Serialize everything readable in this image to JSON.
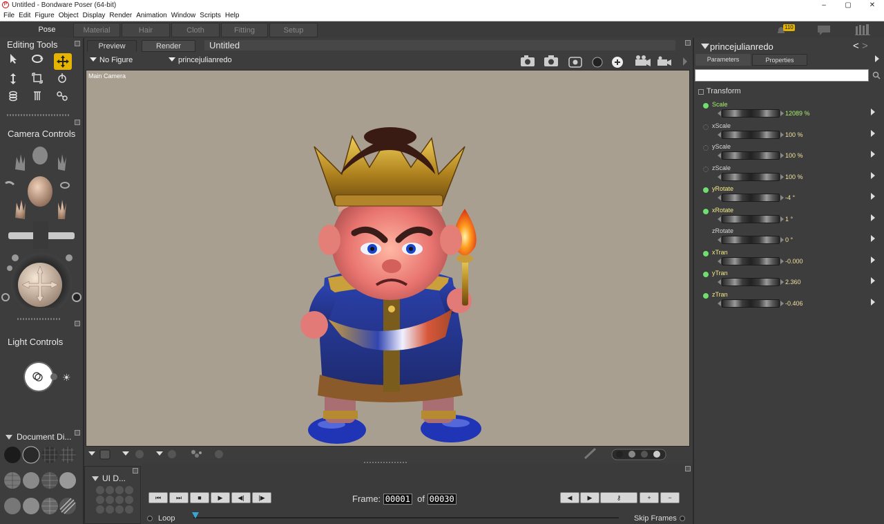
{
  "window": {
    "title": "Untitled - Bondware Poser (64-bit)",
    "minimize": "–",
    "maximize": "▢",
    "close": "✕"
  },
  "menu": [
    "File",
    "Edit",
    "Figure",
    "Object",
    "Display",
    "Render",
    "Animation",
    "Window",
    "Scripts",
    "Help"
  ],
  "rooms": [
    "Pose",
    "Material",
    "Hair",
    "Cloth",
    "Fitting",
    "Setup"
  ],
  "notifications": {
    "badge": "110"
  },
  "panels": {
    "editing_tools": "Editing Tools",
    "camera_controls": "Camera Controls",
    "light_controls": "Light Controls",
    "document_display": "Document  Di...",
    "ui_dots": "UI D..."
  },
  "document": {
    "tabs": [
      "Preview",
      "Render"
    ],
    "name": "Untitled",
    "figure_menu": "No Figure",
    "actor_menu": "princejulianredo",
    "camera_label": "Main Camera"
  },
  "params_panel": {
    "actor": "princejulianredo",
    "tabs": [
      "Parameters",
      "Properties"
    ],
    "search_placeholder": "",
    "group": "Transform",
    "items": [
      {
        "name": "Scale",
        "value": "12089 %",
        "keyed": true
      },
      {
        "name": "xScale",
        "value": "100 %",
        "keyed": false
      },
      {
        "name": "yScale",
        "value": "100 %",
        "keyed": false
      },
      {
        "name": "zScale",
        "value": "100 %",
        "keyed": false
      },
      {
        "name": "yRotate",
        "value": "-4 °",
        "keyed": true
      },
      {
        "name": "xRotate",
        "value": "1 °",
        "keyed": true
      },
      {
        "name": "zRotate",
        "value": "0 °",
        "keyed": false
      },
      {
        "name": "xTran",
        "value": "-0.000",
        "keyed": true
      },
      {
        "name": "yTran",
        "value": "2.360",
        "keyed": true
      },
      {
        "name": "zTran",
        "value": "-0.406",
        "keyed": true
      }
    ]
  },
  "animation": {
    "frame_label": "Frame:",
    "current_frame": "00001",
    "of_label": "of",
    "total_frames": "00030",
    "loop_label": "Loop",
    "skip_label": "Skip Frames"
  },
  "colors": {
    "accent": "#e4b400",
    "viewport_bg": "#a89f91",
    "param_value": "#f0e0a0",
    "keyed_dot": "#6fe06f"
  }
}
